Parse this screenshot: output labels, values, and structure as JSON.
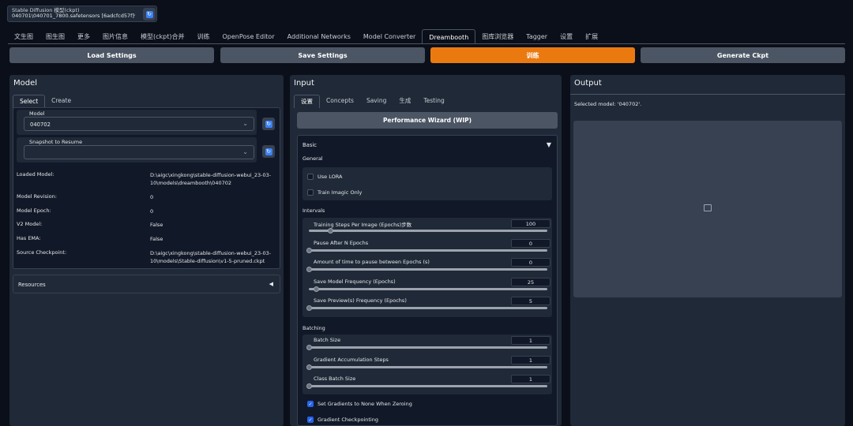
{
  "checkpoint": {
    "label": "Stable Diffusion 模型(ckpt)",
    "value": "040701\\040701_7800.safetensors [6adcfcd57f]"
  },
  "tabs": [
    "文生图",
    "图生图",
    "更多",
    "图片信息",
    "模型(ckpt)合并",
    "训练",
    "OpenPose Editor",
    "Additional Networks",
    "Model Converter",
    "Dreambooth",
    "图库浏览器",
    "Tagger",
    "设置",
    "扩展"
  ],
  "top_buttons": {
    "load": "Load Settings",
    "save": "Save Settings",
    "train": "训练",
    "generate": "Generate Ckpt"
  },
  "model_panel": {
    "title": "Model",
    "subtabs": [
      "Select",
      "Create"
    ],
    "model_label": "Model",
    "model_value": "040702",
    "snapshot_label": "Snapshot to Resume",
    "info": [
      {
        "k": "Loaded Model:",
        "v": "D:\\aigc\\xingkong\\stable-diffusion-webui_23-03-10\\models\\dreambooth\\040702"
      },
      {
        "k": "Model Revision:",
        "v": "0"
      },
      {
        "k": "Model Epoch:",
        "v": "0"
      },
      {
        "k": "V2 Model:",
        "v": "False"
      },
      {
        "k": "Has EMA:",
        "v": "False"
      },
      {
        "k": "Source Checkpoint:",
        "v": "D:\\aigc\\xingkong\\stable-diffusion-webui_23-03-10\\models\\Stable-diffusion\\v1-5-pruned.ckpt"
      }
    ],
    "resources": "Resources"
  },
  "input_panel": {
    "title": "Input",
    "subtabs": [
      "设置",
      "Concepts",
      "Saving",
      "生成",
      "Testing"
    ],
    "wizard": "Performance Wizard (WIP)",
    "basic": "Basic",
    "general": "General",
    "use_lora": "Use LORA",
    "train_imagic": "Train Imagic Only",
    "intervals": "Intervals",
    "interval_sliders": [
      {
        "label": "Training Steps Per Image (Epochs)步数",
        "value": "100",
        "fraction": 0.09
      },
      {
        "label": "Pause After N Epochs",
        "value": "0",
        "fraction": 0
      },
      {
        "label": "Amount of time to pause between Epochs (s)",
        "value": "0",
        "fraction": 0
      },
      {
        "label": "Save Model Frequency (Epochs)",
        "value": "25",
        "fraction": 0.03
      },
      {
        "label": "Save Preview(s) Frequency (Epochs)",
        "value": "5",
        "fraction": 0
      }
    ],
    "batching": "Batching",
    "batch_sliders": [
      {
        "label": "Batch Size",
        "value": "1",
        "fraction": 0
      },
      {
        "label": "Gradient Accumulation Steps",
        "value": "1",
        "fraction": 0
      },
      {
        "label": "Class Batch Size",
        "value": "1",
        "fraction": 0
      }
    ],
    "set_gradients": "Set Gradients to None When Zeroing",
    "grad_checkpointing": "Gradient Checkpointing"
  },
  "output_panel": {
    "title": "Output",
    "selected": "Selected model: '040702'."
  },
  "colors": {
    "accent": "#ea7a10",
    "bg": "#0b0f19",
    "panel": "#1f2937"
  }
}
